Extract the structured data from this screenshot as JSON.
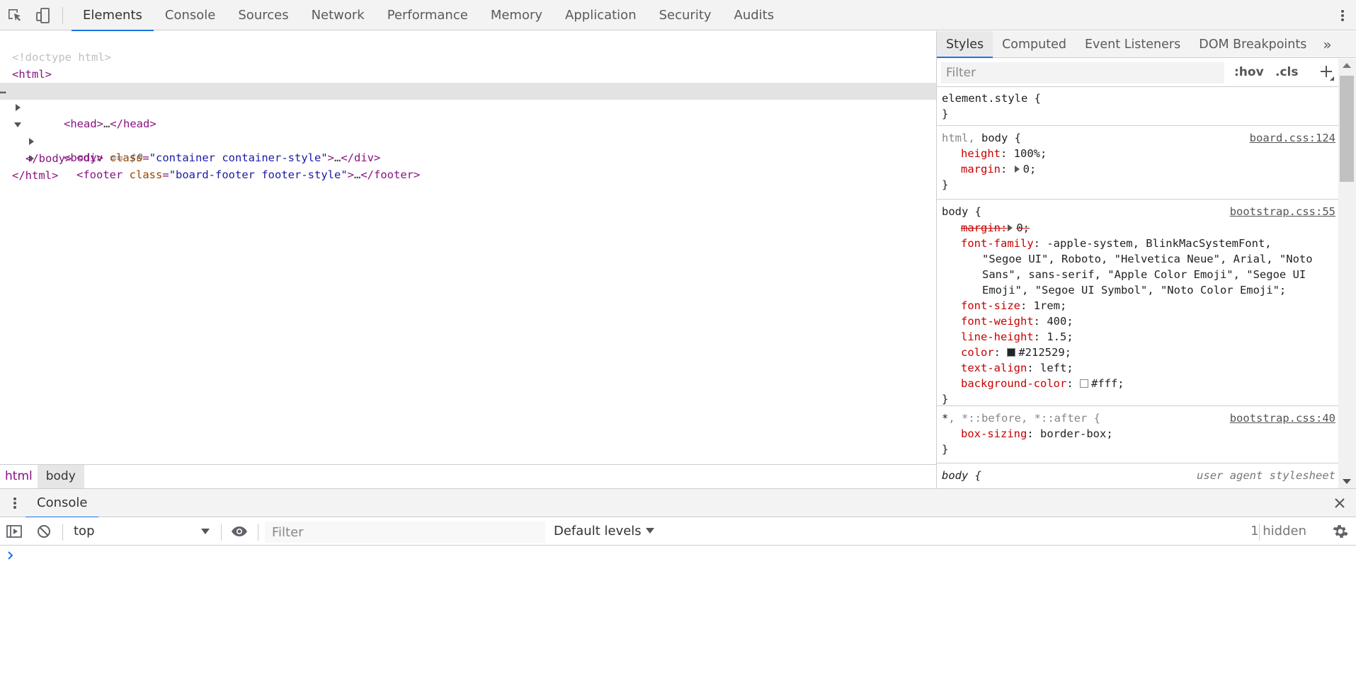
{
  "toolbar": {
    "inspect_icon": "inspect-element-icon",
    "device_icon": "device-toolbar-icon",
    "tabs": [
      "Elements",
      "Console",
      "Sources",
      "Network",
      "Performance",
      "Memory",
      "Application",
      "Security",
      "Audits"
    ],
    "active_tab": "Elements",
    "accent": "#1a73e8"
  },
  "dom_tree": {
    "doctype": "<!doctype html>",
    "html_open": "<html>",
    "head": {
      "open": "<head>",
      "ellipsis": "…",
      "close": "</head>"
    },
    "body": {
      "open": "<body>",
      "marker": " == $0",
      "selected_dots": "…"
    },
    "div": {
      "tag": "<div",
      "attr": "class",
      "value": "\"container container-style\"",
      "end": ">",
      "ellipsis": "…",
      "close": "</div>"
    },
    "footer": {
      "tag": "<footer",
      "attr": "class",
      "value": "\"board-footer footer-style\"",
      "end": ">",
      "ellipsis": "…",
      "close": "</footer>"
    },
    "body_close": "</body>",
    "html_close": "</html>"
  },
  "breadcrumb": [
    "html",
    "body"
  ],
  "styles_pane": {
    "tabs": [
      "Styles",
      "Computed",
      "Event Listeners",
      "DOM Breakpoints"
    ],
    "more": "»",
    "filter_placeholder": "Filter",
    "hov": ":hov",
    "cls": ".cls",
    "rules": {
      "element_style": {
        "selector": "element.style {",
        "close": "}"
      },
      "html_body": {
        "selector_dim": "html, ",
        "selector_main": "body {",
        "source": "board.css:124",
        "props": [
          {
            "name": "height",
            "value": "100%;"
          },
          {
            "name": "margin",
            "value": "0;"
          }
        ],
        "close": "}"
      },
      "body_bootstrap": {
        "selector": "body {",
        "source": "bootstrap.css:55",
        "margin_overridden": "margin:",
        "margin_value": "0;",
        "font_family_name": "font-family",
        "font_family_lines": [
          "-apple-system, BlinkMacSystemFont,",
          "\"Segoe UI\", Roboto, \"Helvetica Neue\", Arial, \"Noto",
          "Sans\", sans-serif, \"Apple Color Emoji\", \"Segoe UI",
          "Emoji\", \"Segoe UI Symbol\", \"Noto Color Emoji\";"
        ],
        "props": [
          {
            "name": "font-size",
            "value": "1rem;"
          },
          {
            "name": "font-weight",
            "value": "400;"
          },
          {
            "name": "line-height",
            "value": "1.5;"
          },
          {
            "name": "color",
            "value": "#212529;",
            "swatch": "#212529"
          },
          {
            "name": "text-align",
            "value": "left;"
          },
          {
            "name": "background-color",
            "value": "#fff;",
            "swatch": "#ffffff"
          }
        ],
        "close": "}"
      },
      "universal": {
        "selector_main": "*",
        "selector_dim": ", *::before, *::after {",
        "source": "bootstrap.css:40",
        "props": [
          {
            "name": "box-sizing",
            "value": "border-box;"
          }
        ],
        "close": "}"
      },
      "user_agent": {
        "selector": "body {",
        "source": "user agent stylesheet"
      }
    }
  },
  "drawer": {
    "tab": "Console",
    "context": "top",
    "filter_placeholder": "Filter",
    "levels": "Default levels",
    "hidden": "1 hidden"
  }
}
